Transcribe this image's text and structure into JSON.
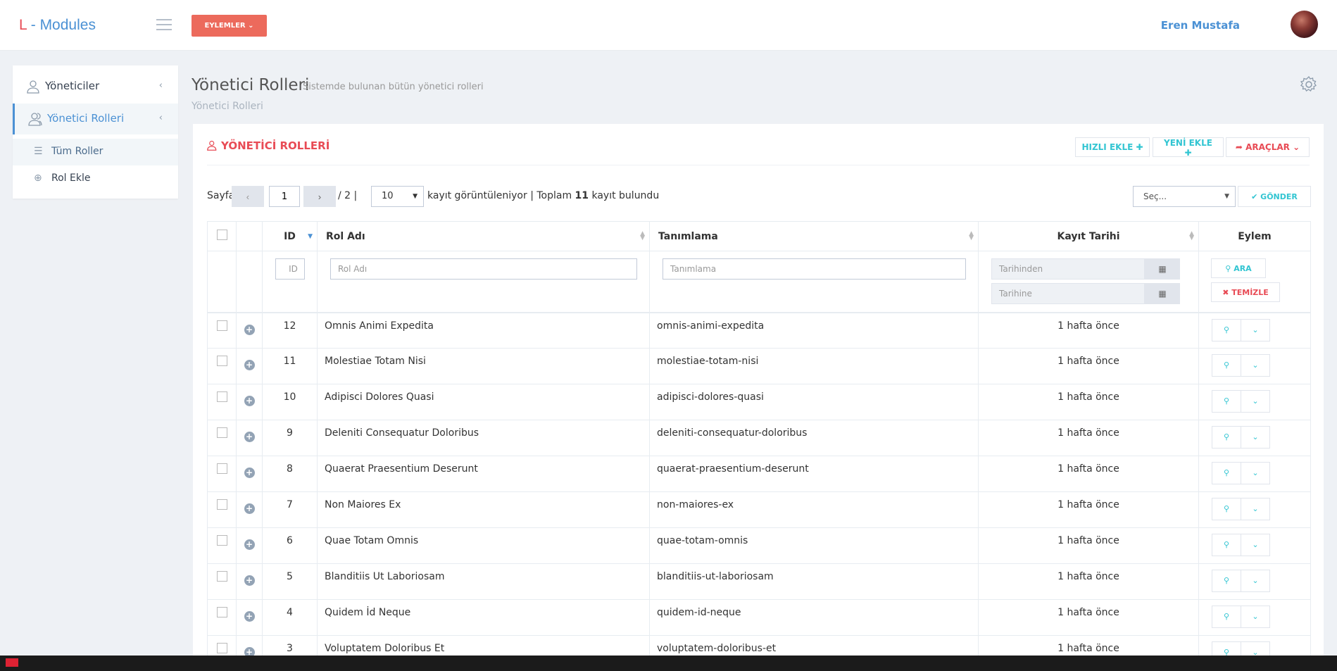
{
  "header": {
    "logo_l": "L",
    "logo_rest": " - Modules",
    "actions_label": "EYLEMLER",
    "user_name": "Eren Mustafa"
  },
  "sidebar": {
    "items": [
      {
        "label": "Yöneticiler"
      },
      {
        "label": "Yönetici Rolleri"
      }
    ],
    "sub_items": [
      {
        "label": "Tüm Roller"
      },
      {
        "label": "Rol Ekle"
      }
    ]
  },
  "page": {
    "title": "Yönetici Rolleri",
    "subtitle": "Sistemde bulunan bütün yönetici rolleri",
    "breadcrumb": "Yönetici Rolleri"
  },
  "portlet": {
    "title": "YÖNETİCİ ROLLERİ",
    "quick_add": "HIZLI EKLE",
    "new_add": "YENİ EKLE",
    "tools": "ARAÇLAR"
  },
  "pager": {
    "label": "Sayfa",
    "page": "1",
    "total_pages": "/ 2 |",
    "per_page": "10",
    "showing_text": "kayıt görüntüleniyor | Toplam",
    "total": "11",
    "found_text": "kayıt bulundu",
    "bulk_placeholder": "Seç...",
    "submit": "GÖNDER"
  },
  "table": {
    "headers": {
      "id": "ID",
      "name": "Rol Adı",
      "desc": "Tanımlama",
      "date": "Kayıt Tarihi",
      "action": "Eylem"
    },
    "filters": {
      "id": "ID",
      "name": "Rol Adı",
      "desc": "Tanımlama",
      "from": "Tarihinden",
      "to": "Tarihine",
      "search": "ARA",
      "clear": "TEMİZLE"
    },
    "rows": [
      {
        "id": "12",
        "name": "Omnis Animi Expedita",
        "desc": "omnis-animi-expedita",
        "date": "1 hafta önce"
      },
      {
        "id": "11",
        "name": "Molestiae Totam Nisi",
        "desc": "molestiae-totam-nisi",
        "date": "1 hafta önce"
      },
      {
        "id": "10",
        "name": "Adipisci Dolores Quasi",
        "desc": "adipisci-dolores-quasi",
        "date": "1 hafta önce"
      },
      {
        "id": "9",
        "name": "Deleniti Consequatur Doloribus",
        "desc": "deleniti-consequatur-doloribus",
        "date": "1 hafta önce"
      },
      {
        "id": "8",
        "name": "Quaerat Praesentium Deserunt",
        "desc": "quaerat-praesentium-deserunt",
        "date": "1 hafta önce"
      },
      {
        "id": "7",
        "name": "Non Maiores Ex",
        "desc": "non-maiores-ex",
        "date": "1 hafta önce"
      },
      {
        "id": "6",
        "name": "Quae Totam Omnis",
        "desc": "quae-totam-omnis",
        "date": "1 hafta önce"
      },
      {
        "id": "5",
        "name": "Blanditiis Ut Laboriosam",
        "desc": "blanditiis-ut-laboriosam",
        "date": "1 hafta önce"
      },
      {
        "id": "4",
        "name": "Quidem İd Neque",
        "desc": "quidem-id-neque",
        "date": "1 hafta önce"
      },
      {
        "id": "3",
        "name": "Voluptatem Doloribus Et",
        "desc": "voluptatem-doloribus-et",
        "date": "1 hafta önce"
      }
    ]
  },
  "colors": {
    "brand_blue": "#4b91d4",
    "accent_red": "#e84b55",
    "accent_cyan": "#32c5d2",
    "button_red": "#ec6a5c"
  }
}
